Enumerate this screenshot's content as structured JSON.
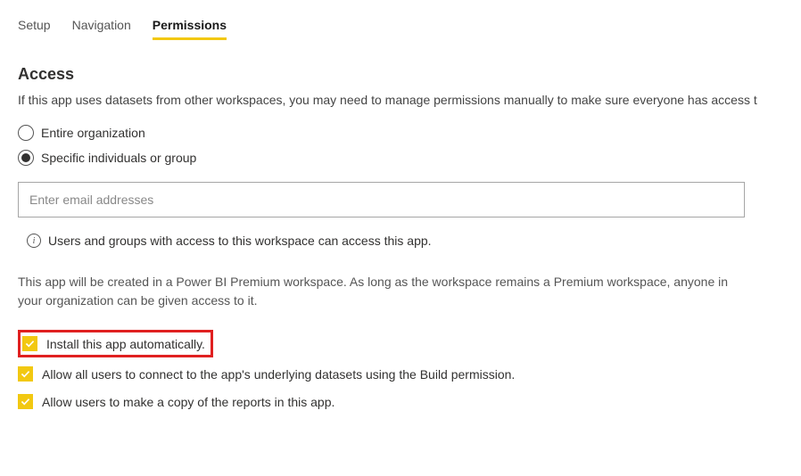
{
  "tabs": {
    "setup": "Setup",
    "navigation": "Navigation",
    "permissions": "Permissions",
    "activeTab": "permissions"
  },
  "access": {
    "heading": "Access",
    "description": "If this app uses datasets from other workspaces, you may need to manage permissions manually to make sure everyone has access t"
  },
  "radios": {
    "entire_org": "Entire organization",
    "specific": "Specific individuals or group",
    "selected": "specific"
  },
  "email_input": {
    "placeholder": "Enter email addresses",
    "value": ""
  },
  "info_text": "Users and groups with access to this workspace can access this app.",
  "premium_note": "This app will be created in a Power BI Premium workspace. As long as the workspace remains a Premium workspace, anyone in your organization can be given access to it.",
  "checkboxes": {
    "install_auto": {
      "label": "Install this app automatically.",
      "checked": true
    },
    "allow_connect": {
      "label": "Allow all users to connect to the app's underlying datasets using the Build permission.",
      "checked": true
    },
    "allow_copy": {
      "label": "Allow users to make a copy of the reports in this app.",
      "checked": true
    }
  }
}
